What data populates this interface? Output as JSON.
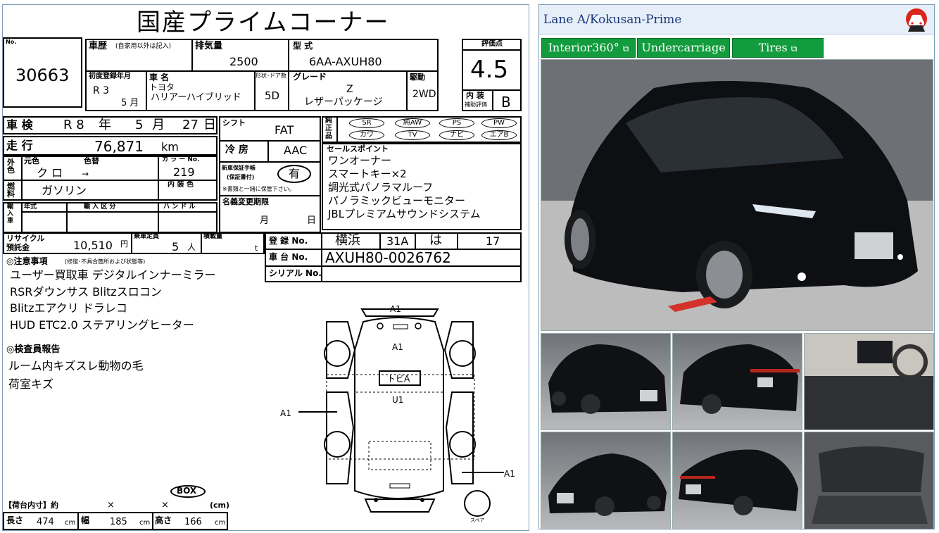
{
  "sheet": {
    "title": "国産プライムコーナー",
    "no_label": "No.",
    "lot_no": "30663",
    "history_label": "車歴",
    "history_sub": "(自家用以外は記入)",
    "displacement_label": "排気量",
    "displacement": "2500",
    "model_label": "型 式",
    "model": "6AA-AXUH80",
    "score_label": "評価点",
    "score": "4.5",
    "first_reg_label": "初度登録年月",
    "first_reg": "R 3",
    "first_reg_month": "5 月",
    "name_label": "車 名",
    "maker": "トヨタ",
    "car_name": "ハリアーハイブリッド",
    "doors_label": "形状･ドア数",
    "doors": "5D",
    "grade_label": "グレード",
    "grade1": "Z",
    "grade2": "レザーパッケージ",
    "drive_label": "駆動",
    "drive": "2WD",
    "interior_label1": "内 装",
    "interior_label2": "補助評価",
    "interior_score": "B",
    "inspection_label": "車 検",
    "inspection_era": "R 8",
    "inspection_y": "年",
    "inspection_month": "5",
    "inspection_m": "月",
    "inspection_day": "27",
    "inspection_d": "日",
    "mileage_label": "走 行",
    "mileage": "76,871",
    "mileage_unit": "km",
    "color_label": "外色",
    "color_orig_label": "元色",
    "color_change_label": "色替",
    "color": "ク ロ",
    "color_arrow": "→",
    "colorno_label": "カ ラ ー No.",
    "colorno": "219",
    "fuel_label": "燃料",
    "fuel": "ガソリン",
    "int_color_label": "内 装 色",
    "import_label": "輸入車",
    "year_label": "年式",
    "import_cat_label": "輸 入 区 分",
    "handle_label": "ハ ン ド ル",
    "shift_label": "シフト",
    "shift": "FAT",
    "ac_label": "冷 房",
    "ac": "AAC",
    "manual_label1": "新車保証手帳",
    "manual_label2": "(保証書付)",
    "manual_value": "有",
    "manual_note": "※書類と一緒に保管下さい。",
    "name_change_label": "名義変更期限",
    "name_change_m": "月",
    "name_change_d": "日",
    "equip_label1": "純",
    "equip_label2": "正",
    "equip_label3": "品",
    "equip": [
      "SR",
      "純AW",
      "PS",
      "PW",
      "カワ",
      "TV",
      "ナビ",
      "エアB"
    ],
    "sales_label": "セールスポイント",
    "sales": [
      "ワンオーナー",
      "スマートキー×2",
      "調光式パノラマルーフ",
      "パノラミックビューモニター",
      "JBLプレミアムサウンドシステム"
    ],
    "recycle_label1": "リサイクル",
    "recycle_label2": "預託金",
    "recycle": "10,510",
    "recycle_unit": "円",
    "capacity_label": "乗車定員",
    "capacity": "5",
    "capacity_unit": "人",
    "load_label": "積載量",
    "load_unit": "t",
    "reg_label": "登 録 No.",
    "reg_place": "横浜",
    "reg_class": "31A",
    "reg_kana": "は",
    "reg_num": "17",
    "chassis_label": "車 台 No.",
    "chassis": "AXUH80-0026762",
    "serial_label": "シリアル No.",
    "notes_label": "◎注意事項",
    "notes_sub": "(修復･不具合箇所および状態等)",
    "notes": [
      "ユーザー買取車 デジタルインナーミラー",
      "RSRダウンサス Blitzスロコン",
      "Blitzエアクリ ドラレコ",
      "HUD ETC2.0 ステアリングヒーター"
    ],
    "inspector_label": "◎検査員報告",
    "inspector": [
      "ルーム内キズスレ動物の毛",
      "荷室キズ"
    ],
    "box_label": "BOX",
    "cargo_label": "【荷台内寸】約",
    "cargo_x1": "×",
    "cargo_x2": "×",
    "cargo_unit": "(cm)",
    "length_label": "長さ",
    "length": "474",
    "width_label": "幅",
    "width": "185",
    "height_label": "高さ",
    "height": "166",
    "cm": "cm",
    "diagram": {
      "top": "A1",
      "roof1": "A1",
      "roof2": "トビA",
      "roof3": "U1",
      "left": "A1",
      "right": "A1",
      "spare": "スペア"
    }
  },
  "panel": {
    "title": "Lane A/Kokusan-Prime",
    "buttons": [
      "Interior360°",
      "Undercarriage",
      "Tires"
    ],
    "colors": {
      "button": "#139c3d",
      "title_bg": "#e6eef8",
      "title_text": "#1a3a7a"
    }
  }
}
